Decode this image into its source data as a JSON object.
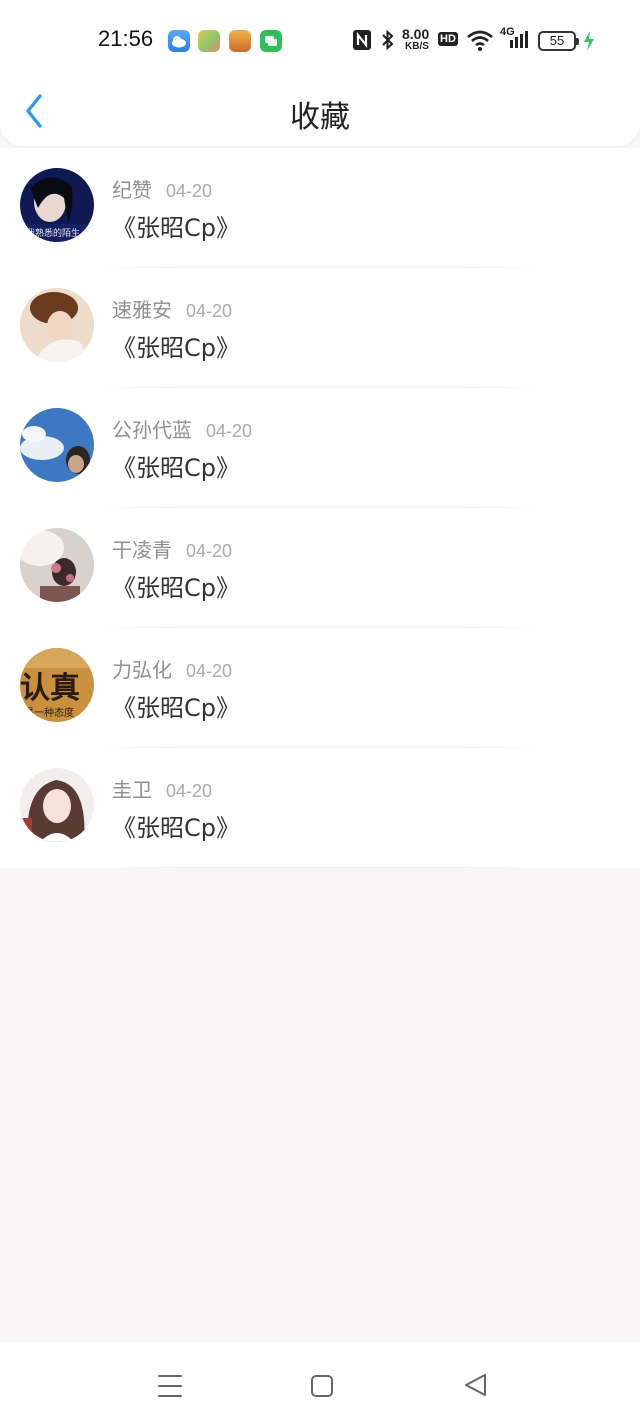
{
  "status_bar": {
    "time": "21:56",
    "net_speed_value": "8.00",
    "net_speed_unit": "KB/S",
    "hd": "HD",
    "signal": "4G",
    "battery": "55",
    "colors": {
      "charging": "#3cc064"
    }
  },
  "header": {
    "title": "收藏",
    "back_icon": "chevron-left-icon",
    "accent": "#2a9cf0"
  },
  "favorites": [
    {
      "name": "纪赞",
      "date": "04-20",
      "content": "《张昭Cp》"
    },
    {
      "name": "速雅安",
      "date": "04-20",
      "content": "《张昭Cp》"
    },
    {
      "name": "公孙代蓝",
      "date": "04-20",
      "content": "《张昭Cp》"
    },
    {
      "name": "干凌青",
      "date": "04-20",
      "content": "《张昭Cp》"
    },
    {
      "name": "力弘化",
      "date": "04-20",
      "content": "《张昭Cp》"
    },
    {
      "name": "圭卫",
      "date": "04-20",
      "content": "《张昭Cp》"
    }
  ],
  "avatar_texts": {
    "first": "我熟悉的陌生",
    "fifth_big": "认真",
    "fifth_small": "是一种态度"
  },
  "system_nav": {
    "menu_icon": "menu-icon",
    "home_icon": "square-home-icon",
    "back_icon": "triangle-back-icon"
  }
}
